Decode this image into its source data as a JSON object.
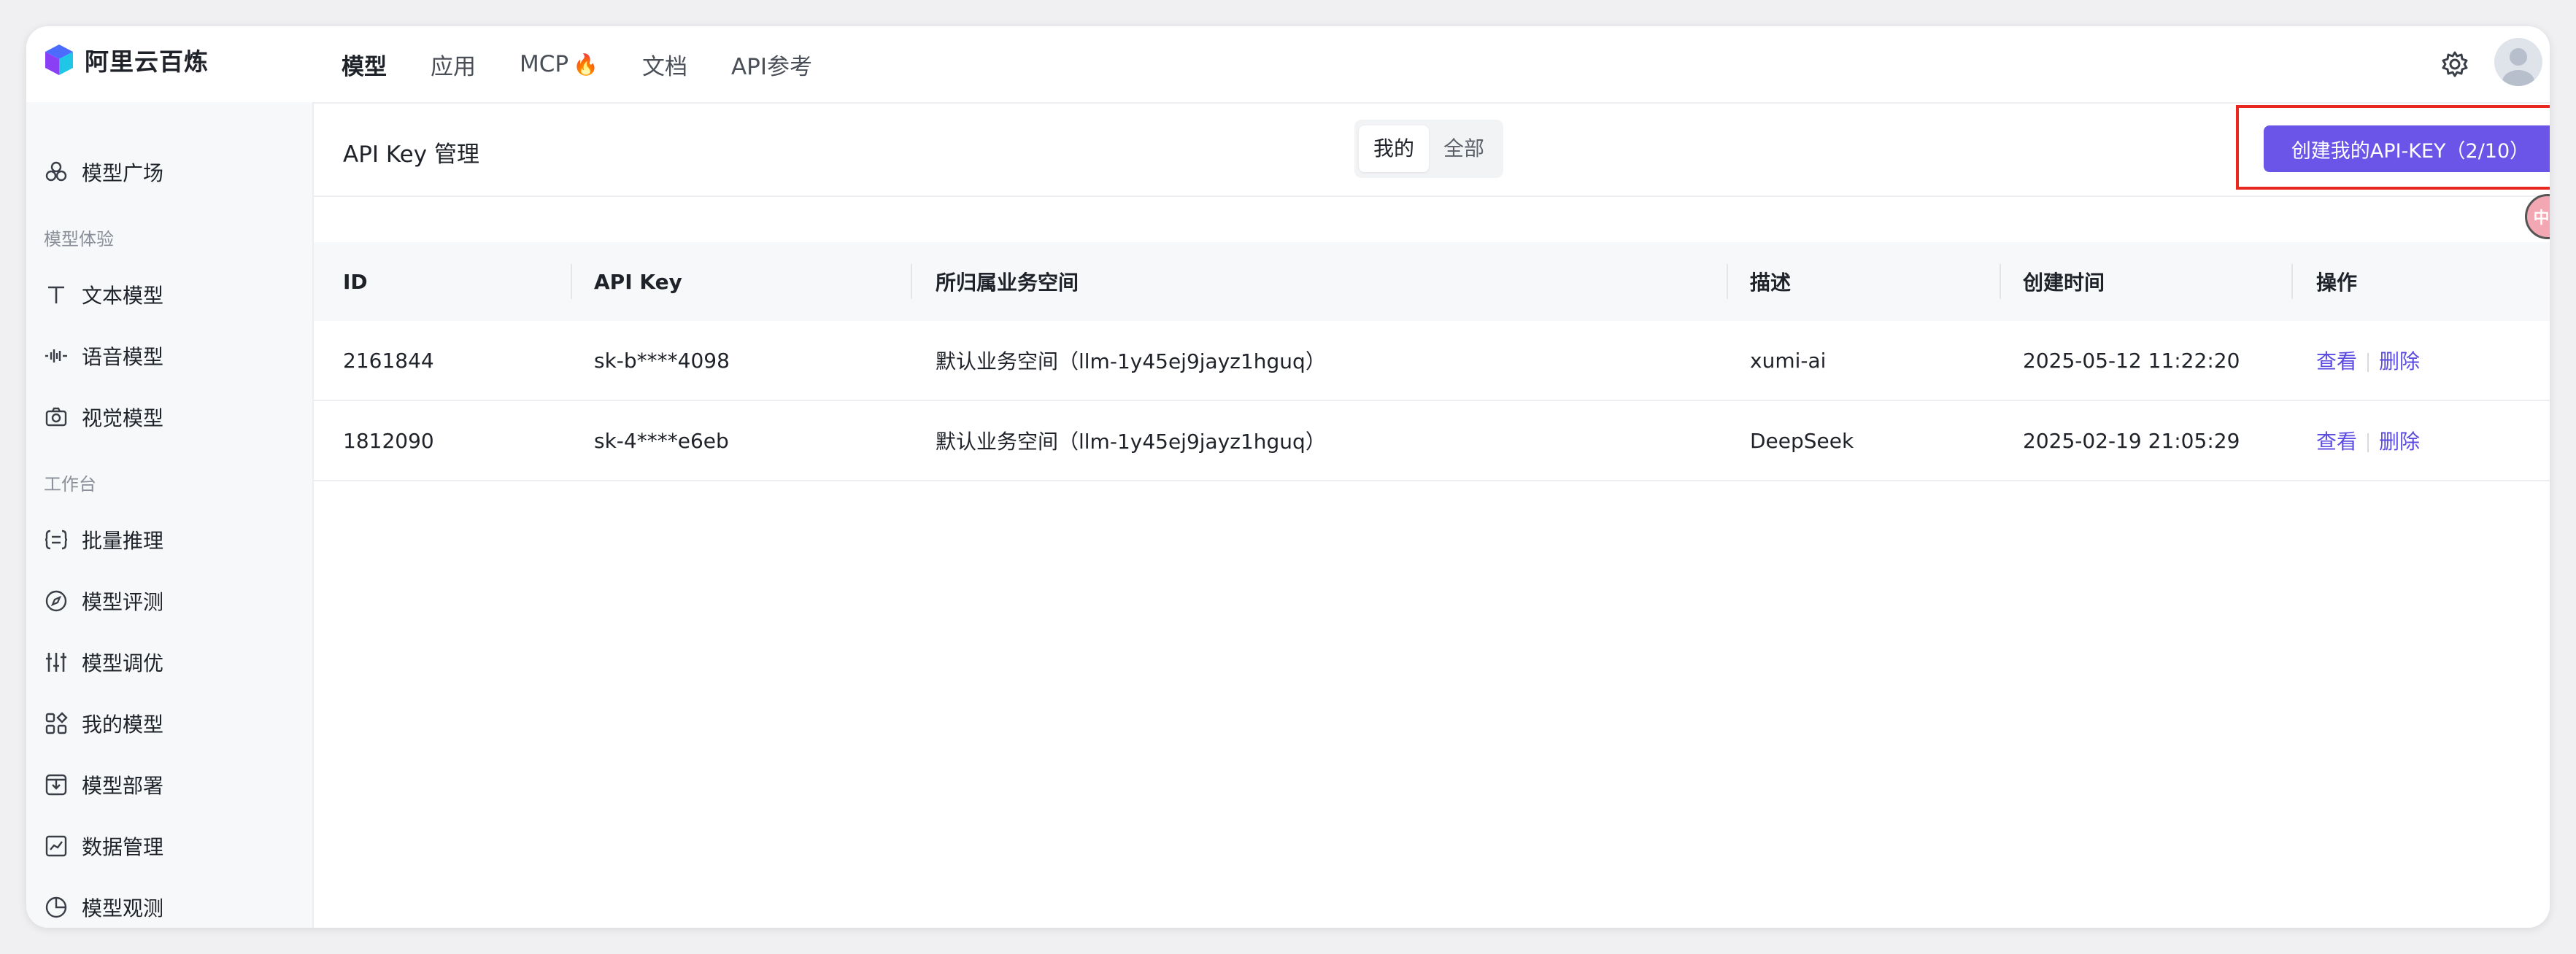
{
  "app": {
    "name": "阿里云百炼"
  },
  "nav": {
    "items": [
      "模型",
      "应用",
      "MCP",
      "文档",
      "API参考"
    ],
    "active": "模型",
    "mcp_badge": "🔥"
  },
  "sidebar": {
    "items": [
      {
        "label": "模型广场",
        "icon": "plaza-icon"
      },
      {
        "section": "模型体验"
      },
      {
        "label": "文本模型",
        "icon": "text-icon"
      },
      {
        "label": "语音模型",
        "icon": "waveform-icon"
      },
      {
        "label": "视觉模型",
        "icon": "camera-icon"
      },
      {
        "section": "工作台"
      },
      {
        "label": "批量推理",
        "icon": "batch-icon"
      },
      {
        "label": "模型评测",
        "icon": "compass-icon"
      },
      {
        "label": "模型调优",
        "icon": "sliders-icon"
      },
      {
        "label": "我的模型",
        "icon": "grid-icon"
      },
      {
        "label": "模型部署",
        "icon": "deploy-icon"
      },
      {
        "label": "数据管理",
        "icon": "chart-icon"
      },
      {
        "label": "模型观测",
        "icon": "pie-icon"
      }
    ]
  },
  "page": {
    "title": "API Key 管理",
    "segment": {
      "options": [
        "我的",
        "全部"
      ],
      "selected": "我的"
    },
    "create_button": "创建我的API-KEY（2/10）",
    "translate_badge": "中A"
  },
  "table": {
    "columns": [
      "ID",
      "API Key",
      "所归属业务空间",
      "描述",
      "创建时间",
      "操作"
    ],
    "rows": [
      {
        "id": "2161844",
        "key": "sk-b****4098",
        "workspace": "默认业务空间（llm-1y45ej9jayz1hguq）",
        "desc": "xumi-ai",
        "created": "2025-05-12 11:22:20",
        "view": "查看",
        "delete": "删除"
      },
      {
        "id": "1812090",
        "key": "sk-4****e6eb",
        "workspace": "默认业务空间（llm-1y45ej9jayz1hguq）",
        "desc": "DeepSeek",
        "created": "2025-02-19 21:05:29",
        "view": "查看",
        "delete": "删除"
      }
    ]
  },
  "colors": {
    "accent": "#6a55e8",
    "highlight": "#e8271f",
    "link": "#5b4be0"
  }
}
